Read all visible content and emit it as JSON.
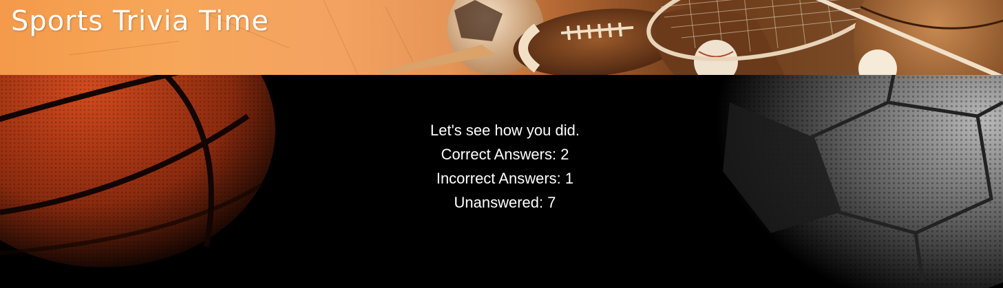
{
  "header": {
    "title": "Sports Trivia Time"
  },
  "results": {
    "intro": "Let's see how you did.",
    "correct_label": "Correct Answers:",
    "correct": 2,
    "incorrect_label": "Incorrect Answers:",
    "incorrect": 1,
    "unanswered_label": "Unanswered:",
    "unanswered": 7
  },
  "colors": {
    "background": "#000000",
    "text": "#ffffff",
    "banner_orange": "#f49a4a"
  }
}
